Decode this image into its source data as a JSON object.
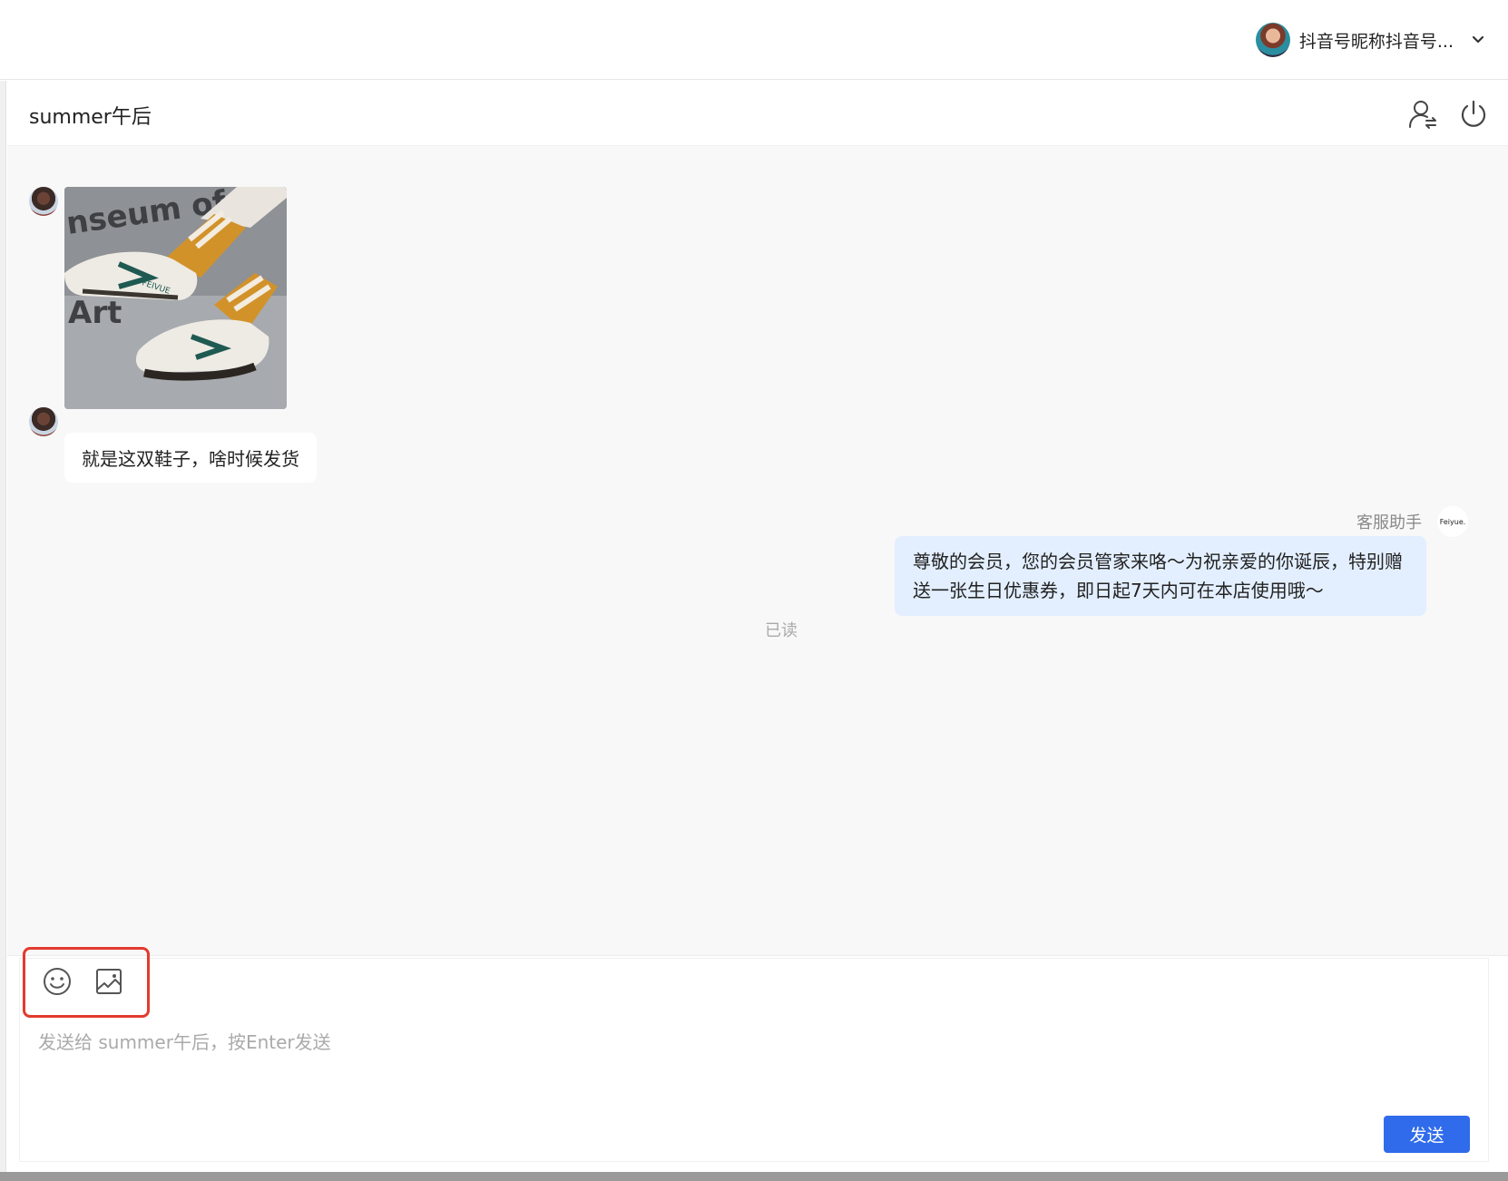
{
  "header": {
    "account_name": "抖音号昵称抖音号..."
  },
  "chat": {
    "title": "summer午后"
  },
  "messages": {
    "customer_text": "就是这双鞋子，啥时候发货",
    "agent_name": "客服助手",
    "agent_logo": "Feiyue.",
    "agent_text": "尊敬的会员，您的会员管家来咯～为祝亲爱的你诞辰，特别赠送一张生日优惠券，即日起7天内可在本店使用哦～",
    "read_status": "已读",
    "image_texts": [
      "nseum of",
      "Art",
      "FEIVUE"
    ]
  },
  "composer": {
    "placeholder": "发送给 summer午后，按Enter发送",
    "send_label": "发送"
  },
  "icons": {
    "account_avatar": "avatar",
    "account_dropdown": "chevron-down-icon",
    "transfer": "user-transfer-icon",
    "end_session": "power-icon",
    "emoji": "smiley-icon",
    "image": "image-icon"
  },
  "colors": {
    "primary": "#2f6bea",
    "outgoing_bubble": "#e3efff",
    "highlight_box": "#e33b2e",
    "message_area_bg": "#f8f8f8"
  }
}
